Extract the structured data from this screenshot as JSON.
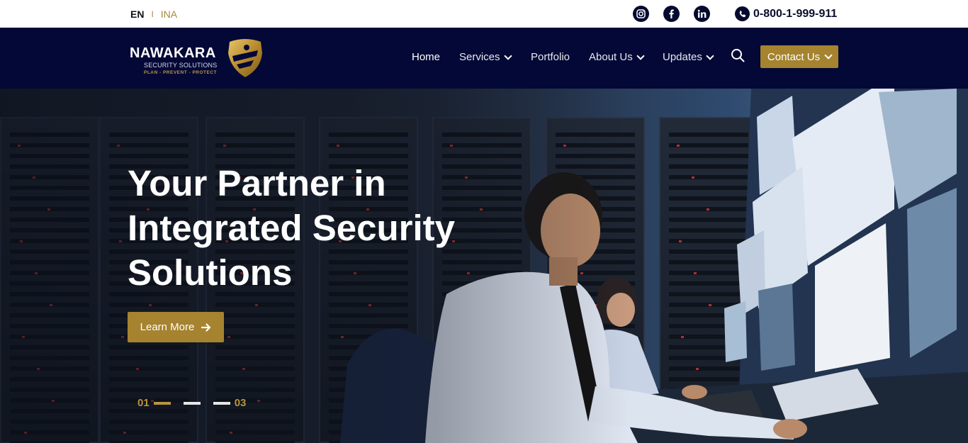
{
  "topbar": {
    "lang_en": "EN",
    "lang_sep": "I",
    "lang_ina": "INA",
    "socials": [
      "instagram-icon",
      "facebook-icon",
      "linkedin-icon"
    ],
    "phone": "0-800-1-999-911"
  },
  "logo": {
    "brand": "NAWAKARA",
    "sub": "SECURITY SOLUTIONS",
    "tagline": "PLAN - PREVENT - PROTECT"
  },
  "nav": {
    "home": "Home",
    "services": "Services",
    "portfolio": "Portfolio",
    "about": "About Us",
    "updates": "Updates",
    "contact": "Contact Us"
  },
  "hero": {
    "title": "Your Partner in Integrated Security Solutions",
    "cta": "Learn More",
    "slide_start": "01",
    "slide_end": "03"
  },
  "colors": {
    "navy": "#040836",
    "gold": "#a5832f"
  }
}
